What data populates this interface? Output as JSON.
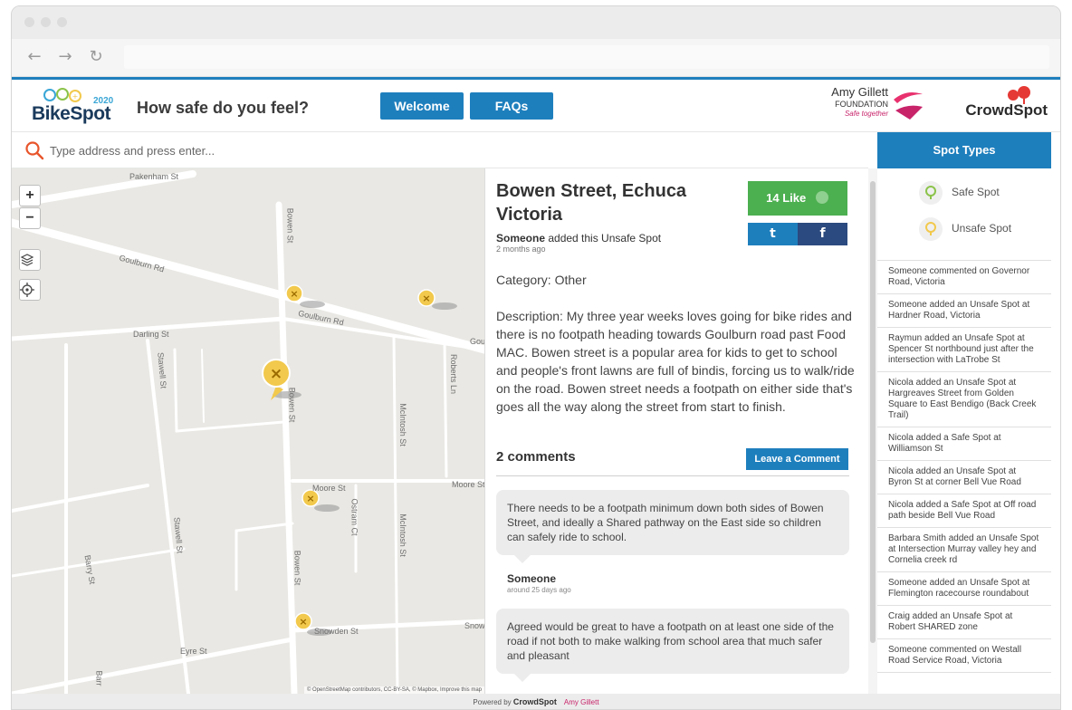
{
  "browser": {
    "back": "←",
    "forward": "→",
    "reload": "↻"
  },
  "header": {
    "logo_text": "BikeSpot",
    "logo_year": "2020",
    "tagline": "How safe do you feel?",
    "nav": [
      "Welcome",
      "FAQs"
    ],
    "sponsor_name": "Amy Gillett",
    "sponsor_sub": "FOUNDATION",
    "sponsor_motto": "Safe together",
    "partner": "CrowdSpot"
  },
  "search": {
    "placeholder": "Type address and press enter..."
  },
  "map": {
    "zoom_in": "+",
    "zoom_out": "−",
    "streets": [
      "Pakenham St",
      "Goulburn Rd",
      "Goulburn Rd",
      "Gou",
      "Darling St",
      "Bowen St",
      "Bowen St",
      "Bowen St",
      "Stawell St",
      "Stawell St",
      "Roberts Ln",
      "McIntosh St",
      "McIntosh St",
      "Moore St",
      "Moore St",
      "Ostram Ct",
      "Barry St",
      "Snowden St",
      "Snow",
      "Eyre St",
      "Barr"
    ],
    "attribution": "© OpenStreetMap contributors, CC-BY-SA, © Mapbox, Improve this map"
  },
  "spot": {
    "close": "×",
    "title": "Bowen Street, Echuca Victoria",
    "like_label": "14 Like",
    "twitter": "t",
    "facebook": "f",
    "author": "Someone",
    "action": " added this Unsafe Spot",
    "time": "2 months ago",
    "category": "Category: Other",
    "description": "Description: My three year weeks loves going for bike rides and there is no footpath heading towards Goulburn road past Food MAC. Bowen street is a popular area for kids to get to school and people's front lawns are full of bindis, forcing us to walk/ride on the road. Bowen street needs a footpath on either side that's goes all the way along the street from start to finish.",
    "comments_count": "2 comments",
    "leave_comment": "Leave a Comment",
    "comments": [
      {
        "text": "There needs to be a footpath minimum down both sides of Bowen Street, and ideally a Shared pathway on the East side so children can safely ride to school.",
        "author": "Someone",
        "time": "around 25 days ago"
      },
      {
        "text": "Agreed would be great to have a footpath on at least one side of the road if not both to make walking from school area that much safer and pleasant",
        "author": "",
        "time": ""
      }
    ]
  },
  "sidebar": {
    "title": "Spot Types",
    "legend": [
      {
        "label": "Safe Spot"
      },
      {
        "label": "Unsafe Spot"
      }
    ],
    "feed": [
      "Someone commented on Governor Road, Victoria",
      "Someone added an Unsafe Spot at Hardner Road, Victoria",
      "Raymun added an Unsafe Spot at Spencer St northbound just after the intersection with LaTrobe St",
      "Nicola added an Unsafe Spot at Hargreaves Street from Golden Square to East Bendigo (Back Creek Trail)",
      "Nicola added a Safe Spot at Williamson St",
      "Nicola added an Unsafe Spot at Byron St at corner Bell Vue Road",
      "Nicola added a Safe Spot at Off road path beside Bell Vue Road",
      "Barbara Smith added an Unsafe Spot at Intersection Murray valley hey and Cornelia creek rd",
      "Someone added an Unsafe Spot at Flemington racecourse roundabout",
      "Craig added an Unsafe Spot at Robert SHARED zone",
      "Someone commented on Westall Road Service Road, Victoria"
    ]
  },
  "footer": {
    "powered": "Powered by ",
    "brand": "CrowdSpot",
    "sponsor": "Amy Gillett"
  },
  "colors": {
    "accent": "#1e7fbd",
    "like": "#4caf50",
    "unsafe": "#f2c94c",
    "safe": "#8bc34a"
  }
}
